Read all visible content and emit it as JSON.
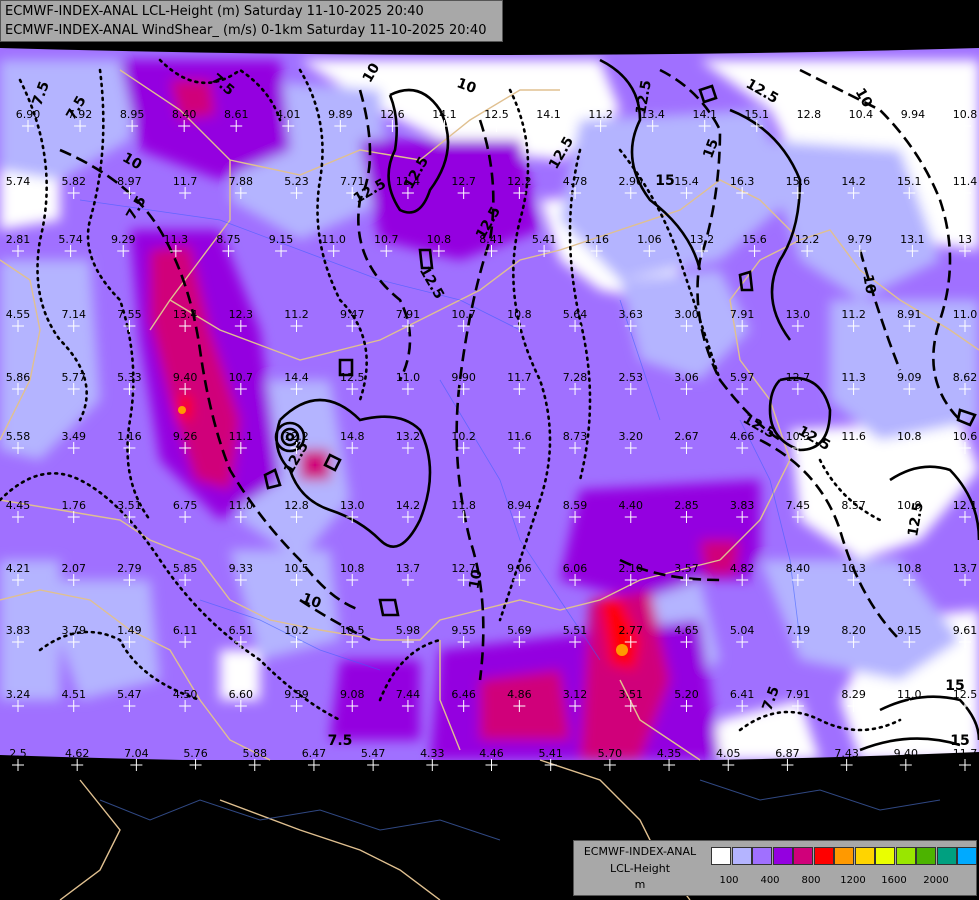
{
  "header": {
    "line1": "ECMWF-INDEX-ANAL LCL-Height (m) Saturday 11-10-2025 20:40",
    "line2": "ECMWF-INDEX-ANAL WindShear_ (m/s) 0-1km Saturday 11-10-2025 20:40"
  },
  "legend": {
    "line1": "ECMWF-INDEX-ANAL",
    "line2": "LCL-Height",
    "line3": "m",
    "colors": [
      "#ffffff",
      "#b4b4ff",
      "#a070ff",
      "#9400e0",
      "#d0007a",
      "#ff0000",
      "#ff9900",
      "#ffd400",
      "#eaff00",
      "#99e600",
      "#4cb300",
      "#00a080",
      "#00aaff"
    ],
    "ticks": [
      "100",
      "400",
      "800",
      "1200",
      "1600",
      "2000"
    ]
  },
  "map": {
    "shear_contour_labels": [
      "7.5",
      "7.5",
      "7.5",
      "7.5",
      "7.5",
      "10",
      "10",
      "10",
      "10",
      "10",
      "10",
      "10",
      "12.5",
      "12.5",
      "12.5",
      "12.5",
      "12.5",
      "12.5",
      "12.5",
      "12.5",
      "12.5",
      "12.5",
      "12.5",
      "15",
      "15",
      "15",
      "7.5",
      "7.5",
      "15",
      "10"
    ],
    "station_values": [
      [
        "6.90",
        "7.92",
        "8.95",
        "8.40",
        "8.61",
        "4.01",
        "9.89",
        "12.6",
        "14.1",
        "12.5",
        "14.1",
        "11.2",
        "13.4",
        "14.1",
        "15.1",
        "12.8",
        "10.4",
        "9.94",
        "10.8"
      ],
      [
        "5.74",
        "5.82",
        "8.97",
        "11.7",
        "7.88",
        "5.23",
        "7.71",
        "11.4",
        "12.7",
        "12.2",
        "4.78",
        "2.90",
        "15.4",
        "16.3",
        "15.6",
        "14.2",
        "15.1",
        "11.4"
      ],
      [
        "2.81",
        "5.74",
        "9.29",
        "11.3",
        "8.75",
        "9.15",
        "11.0",
        "10.7",
        "10.8",
        "8.41",
        "5.41",
        "1.16",
        "1.06",
        "13.2",
        "15.6",
        "12.2",
        "9.79",
        "13.1",
        "13"
      ],
      [
        "4.55",
        "7.14",
        "7.55",
        "13.4",
        "12.3",
        "11.2",
        "9.47",
        "7.91",
        "10.7",
        "10.8",
        "5.64",
        "3.63",
        "3.00",
        "7.91",
        "13.0",
        "11.2",
        "8.91",
        "11.0"
      ],
      [
        "5.86",
        "5.77",
        "5.33",
        "9.40",
        "10.7",
        "14.4",
        "12.5",
        "11.0",
        "9.90",
        "11.7",
        "7.28",
        "2.53",
        "3.06",
        "5.97",
        "12.7",
        "11.3",
        "9.09",
        "8.62"
      ],
      [
        "5.58",
        "3.49",
        "1.16",
        "9.26",
        "11.1",
        "12.2",
        "14.8",
        "13.2",
        "10.2",
        "11.6",
        "8.73",
        "3.20",
        "2.67",
        "4.66",
        "10.3",
        "11.6",
        "10.8",
        "10.6"
      ],
      [
        "4.45",
        "1.76",
        "3.51",
        "6.75",
        "11.0",
        "12.8",
        "13.0",
        "14.2",
        "11.8",
        "8.94",
        "8.59",
        "4.40",
        "2.85",
        "3.83",
        "7.45",
        "8.57",
        "10.9",
        "12.1"
      ],
      [
        "4.21",
        "2.07",
        "2.79",
        "5.85",
        "9.33",
        "10.5",
        "10.8",
        "13.7",
        "12.7",
        "9.06",
        "6.06",
        "2.10",
        "3.57",
        "4.82",
        "8.40",
        "10.3",
        "10.8",
        "13.7"
      ],
      [
        "3.83",
        "3.79",
        "1.49",
        "6.11",
        "6.51",
        "10.2",
        "10.5",
        "5.98",
        "9.55",
        "5.69",
        "5.51",
        "2.77",
        "4.65",
        "5.04",
        "7.19",
        "8.20",
        "9.15",
        "9.61"
      ],
      [
        "3.24",
        "4.51",
        "5.47",
        "4.50",
        "6.60",
        "9.39",
        "9.08",
        "7.44",
        "6.46",
        "4.86",
        "3.12",
        "3.51",
        "5.20",
        "6.41",
        "7.91",
        "8.29",
        "11.0",
        "12.5"
      ],
      [
        "2.5",
        "4.62",
        "7.04",
        "5.76",
        "5.88",
        "6.47",
        "5.47",
        "4.33",
        "4.46",
        "5.41",
        "5.70",
        "4.35",
        "4.05",
        "6.87",
        "7.43",
        "9.40",
        "11.7"
      ]
    ]
  }
}
